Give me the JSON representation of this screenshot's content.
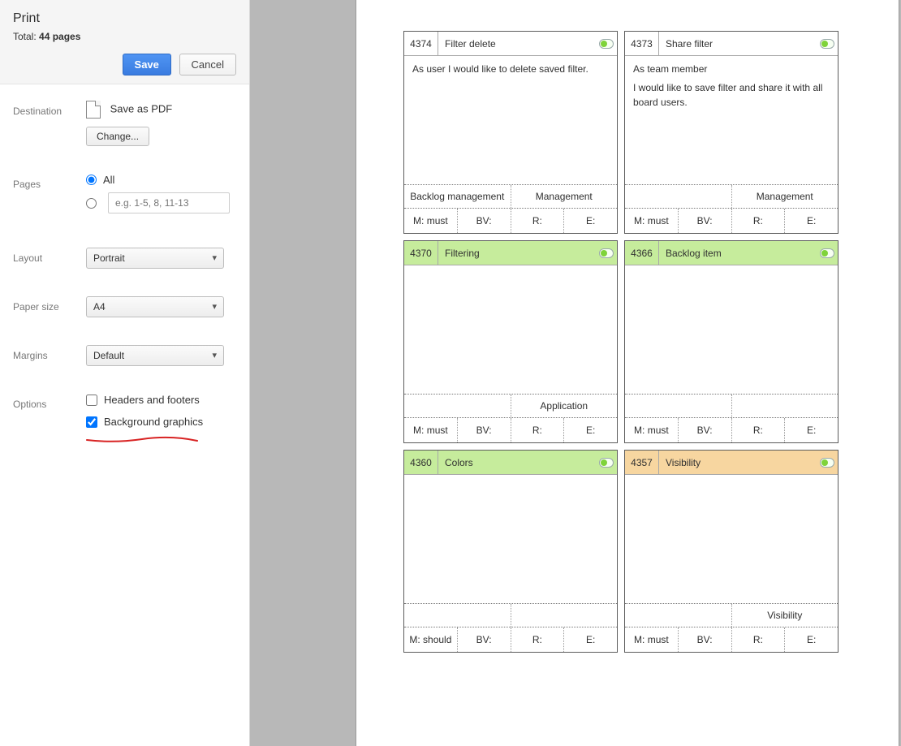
{
  "sidebar": {
    "title": "Print",
    "total_prefix": "Total: ",
    "total_value": "44 pages",
    "save": "Save",
    "cancel": "Cancel",
    "destination_label": "Destination",
    "destination_value": "Save as PDF",
    "change": "Change...",
    "pages_label": "Pages",
    "pages_all": "All",
    "pages_placeholder": "e.g. 1-5, 8, 11-13",
    "layout_label": "Layout",
    "layout_value": "Portrait",
    "paper_label": "Paper size",
    "paper_value": "A4",
    "margins_label": "Margins",
    "margins_value": "Default",
    "options_label": "Options",
    "headers": "Headers and footers",
    "bg_graphics": "Background graphics"
  },
  "cards": [
    {
      "id": "4374",
      "title": "Filter delete",
      "head_class": "",
      "body": [
        "As user I would like to delete saved filter."
      ],
      "tags": [
        "Backlog management",
        "Management"
      ],
      "meta": [
        "M: must",
        "BV:",
        "R:",
        "E:"
      ]
    },
    {
      "id": "4373",
      "title": "Share filter",
      "head_class": "",
      "body": [
        "As team member",
        "I would like to save filter and share it with all board users."
      ],
      "tags": [
        "",
        "Management"
      ],
      "meta": [
        "M: must",
        "BV:",
        "R:",
        "E:"
      ]
    },
    {
      "id": "4370",
      "title": "Filtering",
      "head_class": "green-head",
      "body": [],
      "tags": [
        "",
        "Application"
      ],
      "tag_span": "right",
      "meta": [
        "M: must",
        "BV:",
        "R:",
        "E:"
      ]
    },
    {
      "id": "4366",
      "title": "Backlog item",
      "head_class": "green-head",
      "body": [],
      "tags": [
        "",
        ""
      ],
      "meta": [
        "M: must",
        "BV:",
        "R:",
        "E:"
      ]
    },
    {
      "id": "4360",
      "title": "Colors",
      "head_class": "green-head",
      "body": [],
      "tags": [
        "",
        ""
      ],
      "meta": [
        "M: should",
        "BV:",
        "R:",
        "E:"
      ]
    },
    {
      "id": "4357",
      "title": "Visibility",
      "head_class": "orange-head",
      "body": [],
      "tags": [
        "",
        "Visibility"
      ],
      "meta": [
        "M: must",
        "BV:",
        "R:",
        "E:"
      ]
    }
  ]
}
